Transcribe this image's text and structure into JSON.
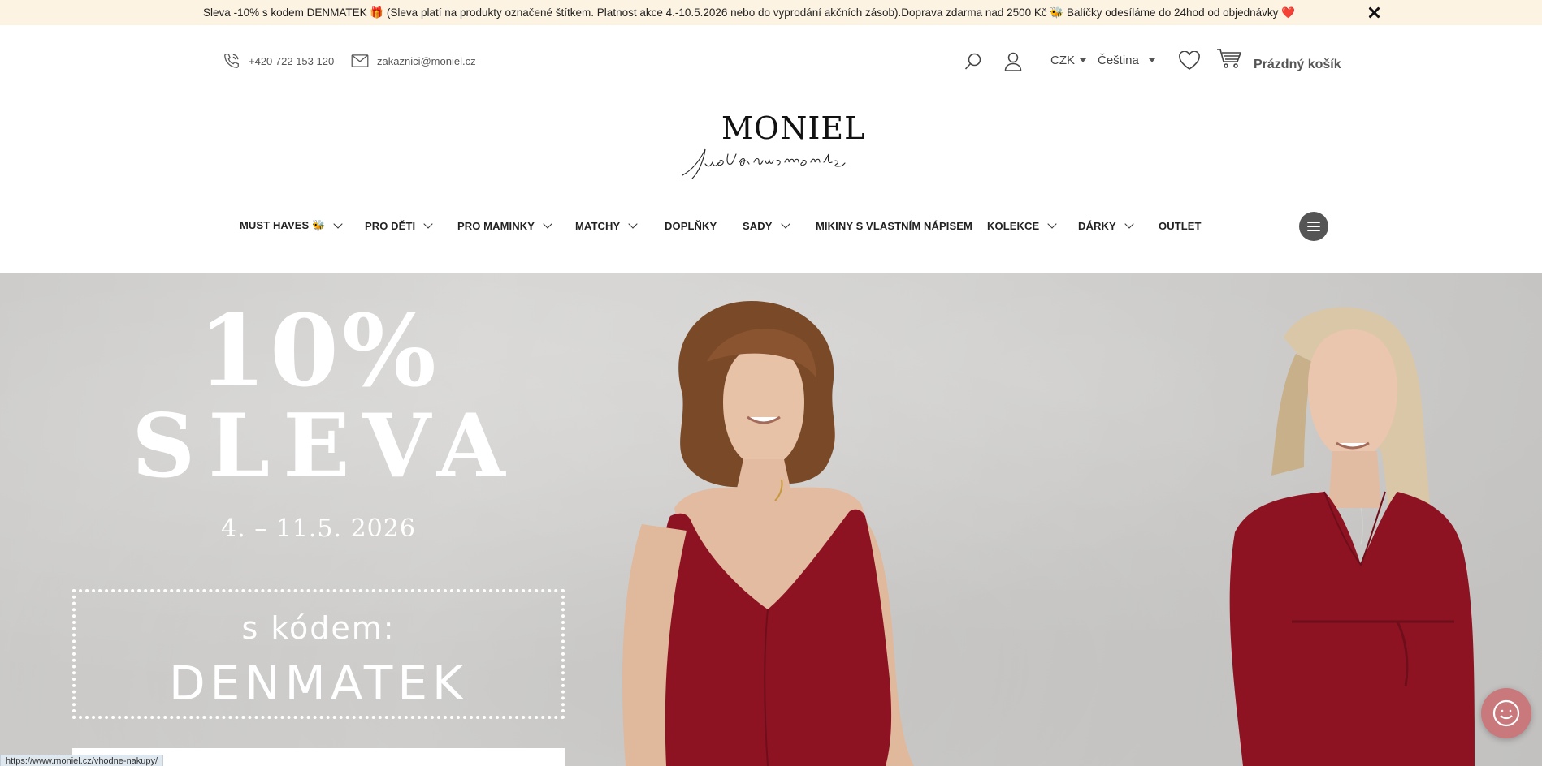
{
  "announcement": {
    "text": "Sleva -10% s kodem DENMATEK 🎁 (Sleva platí na produkty označené štítkem. Platnost akce 4.-10.5.2026 nebo do vyprodání akčních zásob).Doprava zdarma nad 2500 Kč 🐝 Balíčky odesíláme do 24hod od objednávky ❤️"
  },
  "header": {
    "phone": "+420 722 153 120",
    "email": "zakaznici@moniel.cz",
    "currency": "CZK",
    "language": "Čeština",
    "cart_label": "Prázdný košík"
  },
  "logo": {
    "wordmark": "MONIEL",
    "tagline": "just your moments"
  },
  "nav": {
    "items": [
      {
        "label": "MUST HAVES 🐝"
      },
      {
        "label": "PRO DĚTI"
      },
      {
        "label": "PRO MAMINKY"
      },
      {
        "label": "MATCHY"
      },
      {
        "label": "DOPLŇKY"
      },
      {
        "label": "SADY"
      },
      {
        "label": "MIKINY S VLASTNÍM NÁPISEM"
      },
      {
        "label": "KOLEKCE"
      },
      {
        "label": "DÁRKY"
      },
      {
        "label": "OUTLET"
      }
    ]
  },
  "hero": {
    "headline_pct": "10%",
    "headline_word": "SLEVA",
    "dates": "4. – 11.5. 2026",
    "code_label": "s kódem:",
    "code_value": "DENMATEK",
    "dress_color": "#8e1322"
  },
  "status_bar": {
    "url": "https://www.moniel.cz/vhodne-nakupy/"
  },
  "icons": [
    "close-icon",
    "phone-icon",
    "mail-icon",
    "search-icon",
    "user-icon",
    "heart-icon",
    "cart-icon",
    "hamburger-icon",
    "chat-smile-icon"
  ]
}
